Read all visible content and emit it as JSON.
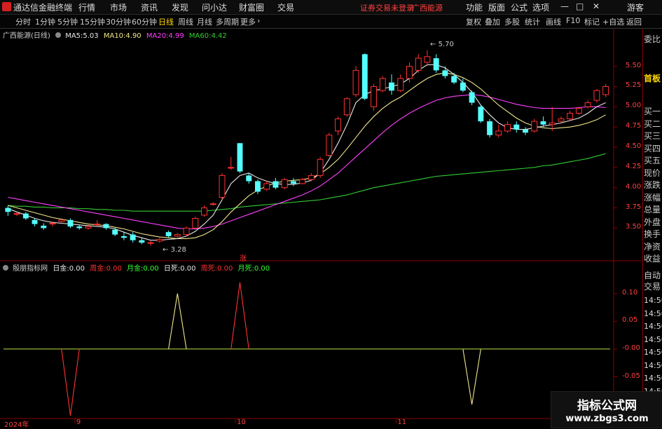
{
  "app": {
    "title": "通达信金融终端",
    "menu": [
      "行情",
      "市场",
      "资讯",
      "发现",
      "问小达",
      "财富圈",
      "交易"
    ],
    "trade_status": "证券交易未登录",
    "stock_name": "广西能源",
    "right_menu": [
      "功能",
      "版面",
      "公式",
      "选项"
    ],
    "user": "游客"
  },
  "toolbar": {
    "periods": [
      "分时",
      "1分钟",
      "5分钟",
      "15分钟",
      "30分钟",
      "60分钟",
      "日线",
      "周线",
      "月线",
      "多周期",
      "更多"
    ],
    "active": "日线",
    "right": [
      "复权",
      "叠加",
      "多股",
      "统计",
      "画线",
      "F10",
      "标记",
      "+自选",
      "返回"
    ]
  },
  "chart_header": {
    "name": "广西能源(日线)",
    "ma": [
      {
        "label": "MA5:",
        "value": "5.03",
        "color": "#e8e8e8"
      },
      {
        "label": "MA10:",
        "value": "4.90",
        "color": "#f0e68c"
      },
      {
        "label": "MA20:",
        "value": "4.99",
        "color": "#ff40ff"
      },
      {
        "label": "MA60:",
        "value": "4.42",
        "color": "#33cc33"
      }
    ]
  },
  "indicator_header": {
    "name": "殷朋指标网",
    "items": [
      {
        "label": "日金:",
        "value": "0.00",
        "color": "#e8e8e8"
      },
      {
        "label": "周金:",
        "value": "0.00",
        "color": "#ff3030"
      },
      {
        "label": "月金:",
        "value": "0.00",
        "color": "#33ff33"
      },
      {
        "label": "日死:",
        "value": "0.00",
        "color": "#e8e8e8"
      },
      {
        "label": "周死:",
        "value": "0.00",
        "color": "#ff3030"
      },
      {
        "label": "月死:",
        "value": "0.00",
        "color": "#33ff33"
      }
    ]
  },
  "price_axis": [
    "5.50",
    "5.25",
    "5.00",
    "4.75",
    "4.50",
    "4.25",
    "4.00",
    "3.75",
    "3.50"
  ],
  "indicator_axis": [
    "0.10",
    "0.05",
    "-0.00",
    "-0.05",
    "-0.10"
  ],
  "date_axis": [
    {
      "label": "2024年"
    },
    {
      "label": "9"
    },
    {
      "label": "10"
    },
    {
      "label": "11"
    }
  ],
  "annotations": {
    "high": "5.70",
    "low": "3.28",
    "rise_marker": "涨"
  },
  "right_panel": {
    "top": [
      "委比",
      "首板"
    ],
    "items": [
      "买一",
      "买二",
      "买三",
      "买四",
      "买五",
      "现价",
      "涨跌",
      "涨幅",
      "总量",
      "外盘",
      "换手",
      "净资",
      "收益"
    ],
    "bottom_title": "自动交易",
    "times": [
      "14:56",
      "14:56",
      "14:56",
      "14:56",
      "14:56",
      "14:56",
      "14:56",
      "14:56"
    ]
  },
  "watermark": {
    "line1": "指标公式网",
    "line2": "www.zbgs3.com"
  },
  "colors": {
    "up": "#ff3232",
    "down": "#54ffff",
    "ma5": "#e8e8e8",
    "ma10": "#f0e68c",
    "ma20": "#ff40ff",
    "ma60": "#33cc33",
    "grid": "#8b0000"
  },
  "chart_data": {
    "type": "candlestick",
    "ylim": [
      3.2,
      5.8
    ],
    "candles": [
      [
        3.75,
        3.7,
        3.78,
        3.65
      ],
      [
        3.68,
        3.68,
        3.7,
        3.65
      ],
      [
        3.68,
        3.62,
        3.7,
        3.6
      ],
      [
        3.6,
        3.55,
        3.62,
        3.52
      ],
      [
        3.53,
        3.5,
        3.56,
        3.48
      ],
      [
        3.55,
        3.56,
        3.58,
        3.52
      ],
      [
        3.58,
        3.6,
        3.62,
        3.56
      ],
      [
        3.6,
        3.52,
        3.62,
        3.5
      ],
      [
        3.52,
        3.5,
        3.54,
        3.48
      ],
      [
        3.5,
        3.52,
        3.54,
        3.48
      ],
      [
        3.55,
        3.55,
        3.6,
        3.52
      ],
      [
        3.55,
        3.5,
        3.56,
        3.48
      ],
      [
        3.48,
        3.42,
        3.5,
        3.4
      ],
      [
        3.4,
        3.38,
        3.45,
        3.35
      ],
      [
        3.42,
        3.35,
        3.45,
        3.32
      ],
      [
        3.35,
        3.32,
        3.38,
        3.3
      ],
      [
        3.32,
        3.32,
        3.34,
        3.28
      ],
      [
        3.34,
        3.36,
        3.38,
        3.32
      ],
      [
        3.45,
        3.4,
        3.47,
        3.38
      ],
      [
        3.4,
        3.42,
        3.44,
        3.38
      ],
      [
        3.42,
        3.5,
        3.52,
        3.4
      ],
      [
        3.5,
        3.62,
        3.64,
        3.48
      ],
      [
        3.66,
        3.75,
        3.78,
        3.64
      ],
      [
        3.8,
        3.8,
        3.82,
        3.78
      ],
      [
        3.88,
        4.15,
        4.18,
        3.85
      ],
      [
        4.25,
        4.25,
        4.38,
        4.22
      ],
      [
        4.55,
        4.2,
        4.55,
        4.18
      ],
      [
        4.15,
        4.08,
        4.18,
        4.05
      ],
      [
        4.08,
        3.95,
        4.1,
        3.92
      ],
      [
        3.98,
        4.05,
        4.08,
        3.96
      ],
      [
        4.08,
        4.0,
        4.12,
        3.98
      ],
      [
        4.0,
        4.1,
        4.12,
        3.98
      ],
      [
        4.08,
        4.05,
        4.12,
        4.02
      ],
      [
        4.05,
        4.1,
        4.12,
        4.04
      ],
      [
        4.1,
        4.15,
        4.18,
        4.08
      ],
      [
        4.15,
        4.35,
        4.38,
        4.12
      ],
      [
        4.4,
        4.65,
        4.68,
        4.38
      ],
      [
        4.7,
        4.85,
        4.88,
        4.65
      ],
      [
        4.9,
        5.1,
        5.12,
        4.88
      ],
      [
        5.15,
        5.45,
        5.5,
        5.12
      ],
      [
        5.65,
        5.1,
        5.66,
        5.08
      ],
      [
        5.0,
        5.25,
        5.28,
        4.95
      ],
      [
        5.2,
        5.35,
        5.38,
        5.18
      ],
      [
        5.3,
        5.2,
        5.4,
        5.15
      ],
      [
        5.2,
        5.35,
        5.4,
        5.18
      ],
      [
        5.35,
        5.5,
        5.55,
        5.3
      ],
      [
        5.45,
        5.6,
        5.65,
        5.42
      ],
      [
        5.55,
        5.62,
        5.7,
        5.5
      ],
      [
        5.6,
        5.45,
        5.65,
        5.42
      ],
      [
        5.45,
        5.38,
        5.5,
        5.35
      ],
      [
        5.38,
        5.3,
        5.42,
        5.28
      ],
      [
        5.3,
        5.2,
        5.35,
        5.18
      ],
      [
        5.18,
        5.05,
        5.2,
        5.02
      ],
      [
        5.0,
        4.82,
        5.02,
        4.8
      ],
      [
        4.82,
        4.65,
        4.85,
        4.62
      ],
      [
        4.65,
        4.7,
        4.78,
        4.62
      ],
      [
        4.7,
        4.78,
        4.82,
        4.68
      ],
      [
        4.78,
        4.72,
        4.82,
        4.68
      ],
      [
        4.72,
        4.68,
        4.75,
        4.65
      ],
      [
        4.7,
        4.82,
        4.85,
        4.68
      ],
      [
        4.82,
        4.78,
        4.88,
        4.75
      ],
      [
        4.78,
        4.8,
        5.0,
        4.7
      ],
      [
        4.82,
        4.85,
        4.88,
        4.8
      ],
      [
        4.85,
        4.92,
        4.95,
        4.82
      ],
      [
        4.92,
        4.98,
        5.0,
        4.9
      ],
      [
        5.0,
        5.05,
        5.08,
        4.98
      ],
      [
        5.08,
        5.2,
        5.22,
        5.05
      ],
      [
        5.15,
        5.25,
        5.28,
        5.12
      ]
    ],
    "ma5": [
      3.74,
      3.7,
      3.66,
      3.62,
      3.59,
      3.57,
      3.56,
      3.55,
      3.54,
      3.53,
      3.52,
      3.51,
      3.49,
      3.45,
      3.41,
      3.38,
      3.35,
      3.35,
      3.36,
      3.37,
      3.4,
      3.46,
      3.55,
      3.66,
      3.85,
      4.05,
      4.15,
      4.18,
      4.12,
      4.08,
      4.05,
      4.04,
      4.04,
      4.06,
      4.09,
      4.18,
      4.35,
      4.55,
      4.78,
      5.05,
      5.15,
      5.2,
      5.22,
      5.25,
      5.28,
      5.35,
      5.45,
      5.52,
      5.52,
      5.48,
      5.4,
      5.3,
      5.18,
      5.02,
      4.9,
      4.8,
      4.74,
      4.72,
      4.72,
      4.74,
      4.76,
      4.78,
      4.8,
      4.83,
      4.86,
      4.92,
      5.0,
      5.05
    ],
    "ma10": [
      3.78,
      3.75,
      3.72,
      3.69,
      3.66,
      3.63,
      3.61,
      3.59,
      3.57,
      3.55,
      3.54,
      3.53,
      3.51,
      3.49,
      3.46,
      3.43,
      3.41,
      3.39,
      3.38,
      3.37,
      3.37,
      3.38,
      3.42,
      3.48,
      3.58,
      3.7,
      3.8,
      3.9,
      3.97,
      4.02,
      4.06,
      4.08,
      4.09,
      4.1,
      4.12,
      4.17,
      4.25,
      4.35,
      4.48,
      4.62,
      4.76,
      4.88,
      4.98,
      5.06,
      5.12,
      5.2,
      5.28,
      5.35,
      5.4,
      5.42,
      5.4,
      5.36,
      5.3,
      5.22,
      5.12,
      5.02,
      4.94,
      4.86,
      4.8,
      4.76,
      4.74,
      4.73,
      4.74,
      4.75,
      4.77,
      4.8,
      4.84,
      4.9
    ],
    "ma20": [
      3.88,
      3.86,
      3.84,
      3.82,
      3.8,
      3.78,
      3.76,
      3.74,
      3.72,
      3.7,
      3.68,
      3.66,
      3.64,
      3.62,
      3.6,
      3.58,
      3.56,
      3.54,
      3.52,
      3.5,
      3.49,
      3.49,
      3.5,
      3.52,
      3.55,
      3.59,
      3.63,
      3.67,
      3.71,
      3.75,
      3.79,
      3.83,
      3.87,
      3.91,
      3.96,
      4.02,
      4.1,
      4.18,
      4.28,
      4.38,
      4.48,
      4.58,
      4.68,
      4.77,
      4.85,
      4.92,
      4.98,
      5.03,
      5.08,
      5.11,
      5.13,
      5.14,
      5.15,
      5.14,
      5.12,
      5.09,
      5.06,
      5.03,
      5.01,
      4.99,
      4.98,
      4.98,
      4.98,
      4.98,
      4.99,
      5.0,
      5.0,
      4.99
    ],
    "ma60": [
      3.78,
      3.77,
      3.77,
      3.76,
      3.76,
      3.75,
      3.75,
      3.75,
      3.74,
      3.74,
      3.73,
      3.73,
      3.72,
      3.72,
      3.71,
      3.71,
      3.71,
      3.71,
      3.71,
      3.71,
      3.71,
      3.71,
      3.71,
      3.72,
      3.73,
      3.74,
      3.76,
      3.77,
      3.78,
      3.79,
      3.8,
      3.81,
      3.82,
      3.83,
      3.84,
      3.85,
      3.87,
      3.89,
      3.91,
      3.94,
      3.97,
      4.0,
      4.02,
      4.04,
      4.06,
      4.08,
      4.1,
      4.12,
      4.14,
      4.15,
      4.16,
      4.17,
      4.18,
      4.19,
      4.2,
      4.21,
      4.22,
      4.23,
      4.24,
      4.25,
      4.27,
      4.28,
      4.3,
      4.32,
      4.34,
      4.36,
      4.39,
      4.42
    ],
    "indicator": {
      "ylim": [
        -0.11,
        0.13
      ],
      "baseline": 0,
      "spikes": [
        {
          "bar": 7,
          "value": -0.12,
          "color": "#ff3232"
        },
        {
          "bar": 19,
          "value": 0.1,
          "color": "#f0e68c"
        },
        {
          "bar": 26,
          "value": 0.12,
          "color": "#ff3232"
        },
        {
          "bar": 52,
          "value": -0.1,
          "color": "#f0e68c"
        }
      ]
    }
  }
}
